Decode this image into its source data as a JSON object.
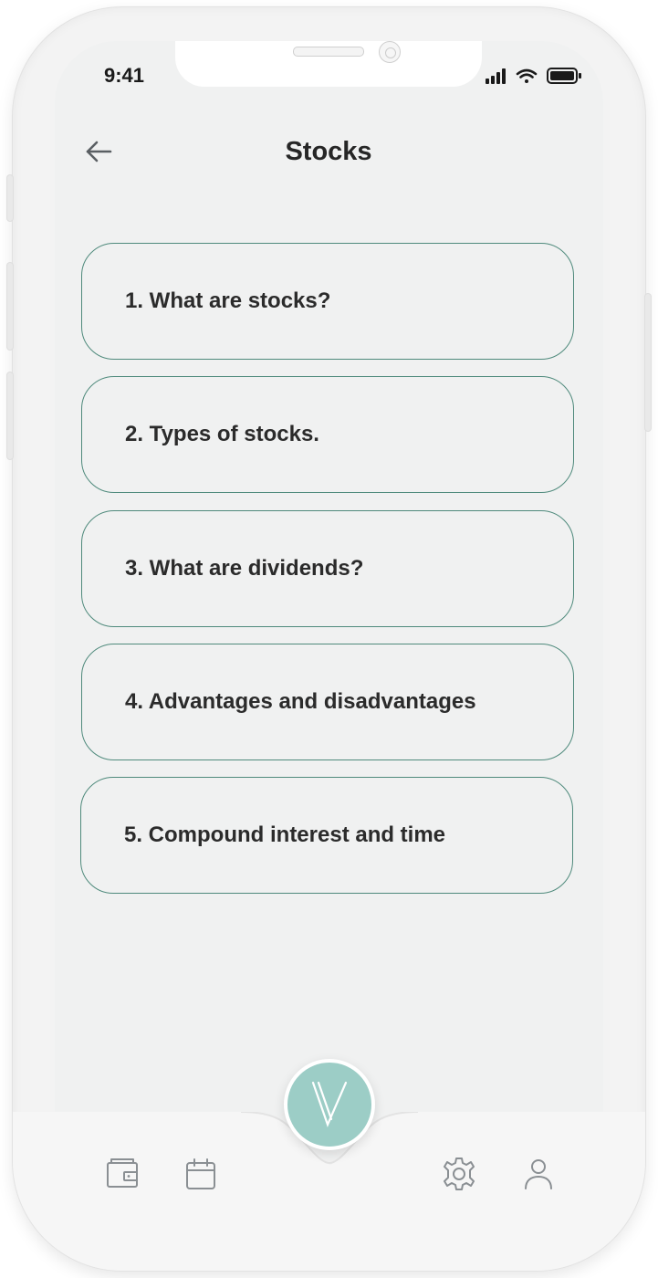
{
  "status_bar": {
    "time": "9:41"
  },
  "header": {
    "title": "Stocks",
    "back_icon": "arrow-left-icon"
  },
  "topics": [
    {
      "label": "1. What are stocks?"
    },
    {
      "label": "2. Types of stocks."
    },
    {
      "label": "3. What are dividends?"
    },
    {
      "label": "4. Advantages and disadvantages"
    },
    {
      "label": "5. Compound interest and time"
    }
  ],
  "tab_bar": {
    "items": [
      {
        "icon": "wallet-icon"
      },
      {
        "icon": "calendar-icon"
      },
      {
        "icon": "logo-icon"
      },
      {
        "icon": "gear-icon"
      },
      {
        "icon": "user-icon"
      }
    ]
  },
  "colors": {
    "accent": "#9ccdc6",
    "card_border": "#4f8a7c",
    "screen_bg": "#f0f1f1",
    "icon_gray": "#8a8f93",
    "text": "#2b2b2b"
  }
}
